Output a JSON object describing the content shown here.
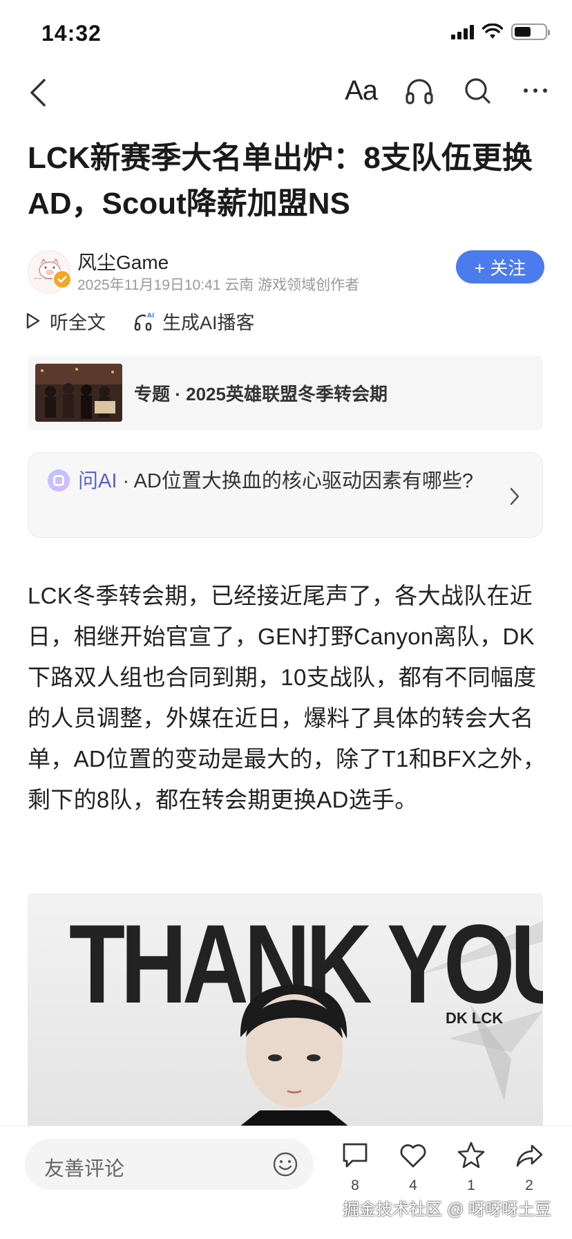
{
  "status_bar": {
    "time": "14:32",
    "battery_level": 0.55
  },
  "nav": {
    "font_label": "Aa",
    "icons": [
      "back-icon",
      "headphones-icon",
      "search-icon",
      "more-icon"
    ]
  },
  "article": {
    "title": "LCK新赛季大名单出炉：8支队伍更换AD，Scout降薪加盟NS",
    "author": {
      "name": "风尘Game",
      "meta": "2025年11月19日10:41 云南 游戏领域创作者",
      "follow_label": "+ 关注"
    },
    "listen_label": "听全文",
    "podcast_label": "生成AI播客",
    "topic": {
      "text": "专题 · 2025英雄联盟冬季转会期"
    },
    "ask_ai": {
      "brand": "问AI",
      "question": " · AD位置大换血的核心驱动因素有哪些?"
    },
    "body": "LCK冬季转会期，已经接近尾声了，各大战队在近日，相继开始官宣了，GEN打野Canyon离队，DK下路双人组也合同到期，10支战队，都有不同幅度的人员调整，外媒在近日，爆料了具体的转会大名单，AD位置的变动是最大的，除了T1和BFX之外，剩下的8队，都在转会期更换AD选手。",
    "image": {
      "headline": "THANK YOU",
      "tag": "DK LCK"
    }
  },
  "bottom_bar": {
    "comment_placeholder": "友善评论",
    "actions": [
      {
        "name": "comment",
        "count": "8"
      },
      {
        "name": "like",
        "count": "4"
      },
      {
        "name": "favorite",
        "count": "1"
      },
      {
        "name": "share",
        "count": "2"
      }
    ],
    "watermark": "掘金技术社区 @ 呀呀呀土豆"
  },
  "colors": {
    "accent": "#4b7bec",
    "ai_brand": "#5a5fd6"
  }
}
